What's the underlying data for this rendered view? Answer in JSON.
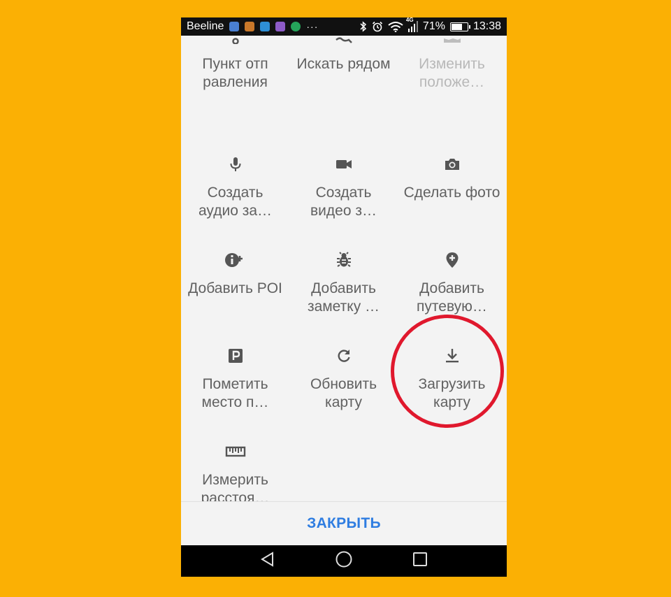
{
  "status_bar": {
    "carrier": "Beeline",
    "dots": "···",
    "network_type": "4G",
    "battery_percent": "71%",
    "battery_level": 0.71,
    "time": "13:38"
  },
  "menu": {
    "items": [
      {
        "label": "Пункт отп равления",
        "icon": "start-point-icon",
        "disabled": false
      },
      {
        "label": "Искать рядом",
        "icon": "search-nearby-icon",
        "disabled": false
      },
      {
        "label": "Изменить положе…",
        "icon": "map-icon",
        "disabled": true
      },
      {
        "label": "Создать аудио за…",
        "icon": "microphone-icon",
        "disabled": false
      },
      {
        "label": "Создать видео з…",
        "icon": "video-camera-icon",
        "disabled": false
      },
      {
        "label": "Сделать фото",
        "icon": "camera-icon",
        "disabled": false
      },
      {
        "label": "Добавить POI",
        "icon": "add-poi-icon",
        "disabled": false
      },
      {
        "label": "Добавить заметку …",
        "icon": "bug-icon",
        "disabled": false
      },
      {
        "label": "Добавить путевую…",
        "icon": "add-waypoint-icon",
        "disabled": false
      },
      {
        "label": "Пометить место п…",
        "icon": "parking-icon",
        "disabled": false
      },
      {
        "label": "Обновить карту",
        "icon": "refresh-icon",
        "disabled": false
      },
      {
        "label": "Загрузить карту",
        "icon": "download-icon",
        "disabled": false
      },
      {
        "label": "Измерить расстоя…",
        "icon": "ruler-icon",
        "disabled": false
      }
    ]
  },
  "close_label": "ЗАКРЫТЬ",
  "colors": {
    "background": "#FBB004",
    "accent": "#2F7DE1",
    "highlight_circle": "#E0182D",
    "icon": "#555555",
    "disabled_text": "#B8B8B8"
  }
}
